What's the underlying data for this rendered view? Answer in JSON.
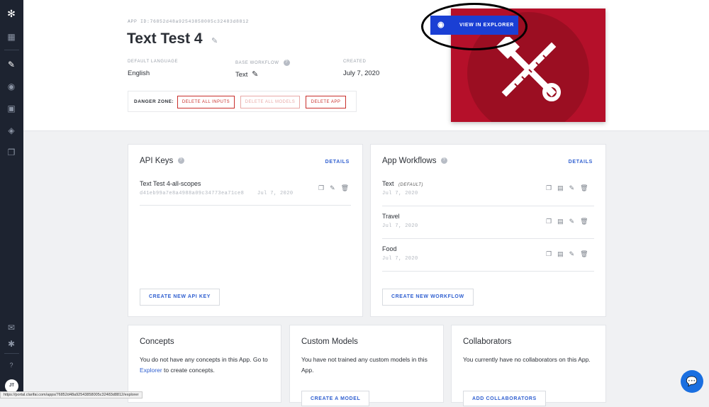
{
  "sidebar": {
    "icons": [
      {
        "name": "logo-icon",
        "glyph": "✻"
      },
      {
        "name": "grid-icon",
        "glyph": "▦"
      },
      {
        "name": "edit-icon",
        "glyph": "✎"
      },
      {
        "name": "eye-icon",
        "glyph": "◉"
      },
      {
        "name": "apps-icon",
        "glyph": "▣"
      },
      {
        "name": "tag-icon",
        "glyph": "◈"
      },
      {
        "name": "copy-icon",
        "glyph": "❐"
      },
      {
        "name": "megaphone-icon",
        "glyph": "✉"
      },
      {
        "name": "bug-icon",
        "glyph": "✱"
      },
      {
        "name": "help-icon",
        "glyph": "?"
      }
    ],
    "avatar_initials": "JT"
  },
  "app": {
    "id_line": "APP ID:76852d48a92543858005c32483d8812",
    "title": "Text Test 4",
    "default_language_label": "DEFAULT LANGUAGE",
    "default_language": "English",
    "base_workflow_label": "BASE WORKFLOW",
    "base_workflow": "Text",
    "created_label": "CREATED",
    "created": "July 7, 2020"
  },
  "danger_zone": {
    "label": "DANGER ZONE:",
    "delete_inputs": "DELETE ALL INPUTS",
    "delete_models": "DELETE ALL MODELS",
    "delete_app": "DELETE APP"
  },
  "hero": {
    "view_in_explorer": "VIEW IN EXPLORER",
    "accent": "#b5102a",
    "button_color": "#1a3fd4"
  },
  "api_keys": {
    "title": "API Keys",
    "details": "DETAILS",
    "items": [
      {
        "name": "Text Test 4-all-scopes",
        "key": "d41eb99a7e8a4988a09c34773ea71ce8",
        "date": "Jul 7, 2020"
      }
    ],
    "create_button": "CREATE NEW API KEY"
  },
  "workflows": {
    "title": "App Workflows",
    "details": "DETAILS",
    "items": [
      {
        "name": "Text",
        "tag": "(DEFAULT)",
        "date": "Jul 7, 2020"
      },
      {
        "name": "Travel",
        "tag": "",
        "date": "Jul 7, 2020"
      },
      {
        "name": "Food",
        "tag": "",
        "date": "Jul 7, 2020"
      }
    ],
    "create_button": "CREATE NEW WORKFLOW"
  },
  "concepts": {
    "title": "Concepts",
    "text_before": "You do not have any concepts in this App. Go to ",
    "link": "Explorer",
    "text_after": " to create concepts."
  },
  "custom_models": {
    "title": "Custom Models",
    "text": "You have not trained any custom models in this App.",
    "button": "CREATE A MODEL"
  },
  "collaborators": {
    "title": "Collaborators",
    "text": "You currently have no collaborators on this App.",
    "button": "ADD COLLABORATORS"
  },
  "status_url": "https://portal.clarifai.com/apps/76852d48a92543858005c32483d8812/explorer"
}
